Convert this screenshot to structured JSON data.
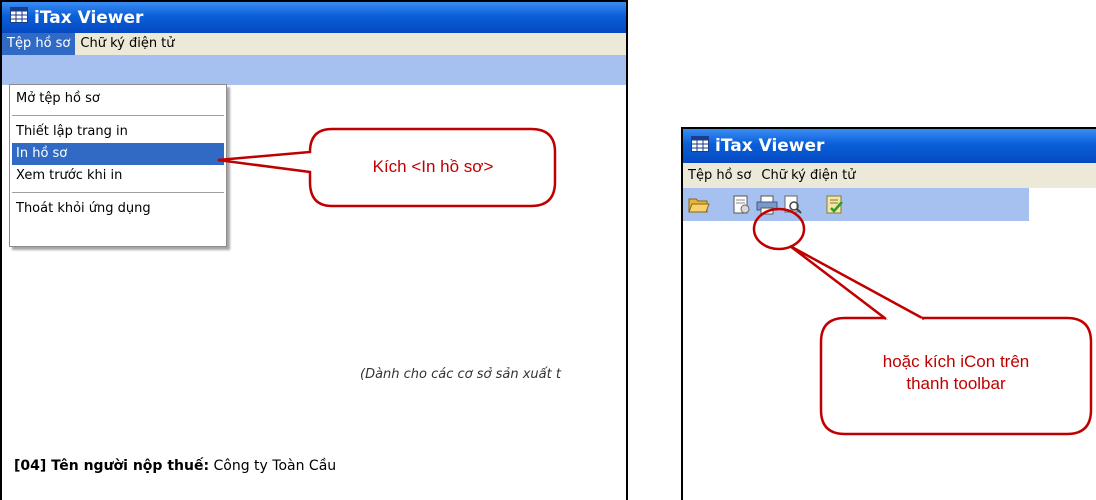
{
  "window_left": {
    "title": "iTax Viewer",
    "menu": {
      "file": "Tệp hồ sơ",
      "signature": "Chữ ký điện tử"
    },
    "dropdown": [
      "Mở tệp hồ sơ",
      "Thiết lập trang in",
      "In hồ sơ",
      "Xem trước khi in",
      "Thoát khỏi ứng dụng"
    ],
    "doc_note": "(Dành cho các cơ sở sản xuất t",
    "taxpayer_label": "[04] Tên người nộp thuế:",
    "taxpayer_value": "Công ty Toàn Cầu"
  },
  "window_right": {
    "title": "iTax Viewer",
    "menu": {
      "file": "Tệp hồ sơ",
      "signature": "Chữ ký điện tử"
    },
    "toolbar_icons": [
      "folder-open-icon",
      "document-icon",
      "printer-icon",
      "print-preview-icon",
      "checklist-icon"
    ]
  },
  "callouts": {
    "print_menu": "Kích <In hồ sơ>",
    "print_icon_line1": "hoặc kích iCon trên",
    "print_icon_line2": "thanh toolbar"
  },
  "colors": {
    "titlebar": "#0a5fd8",
    "menubar": "#ece9d8",
    "toolbar": "#a6c1f0",
    "selection": "#316ac5",
    "callout_border": "#c00000"
  }
}
